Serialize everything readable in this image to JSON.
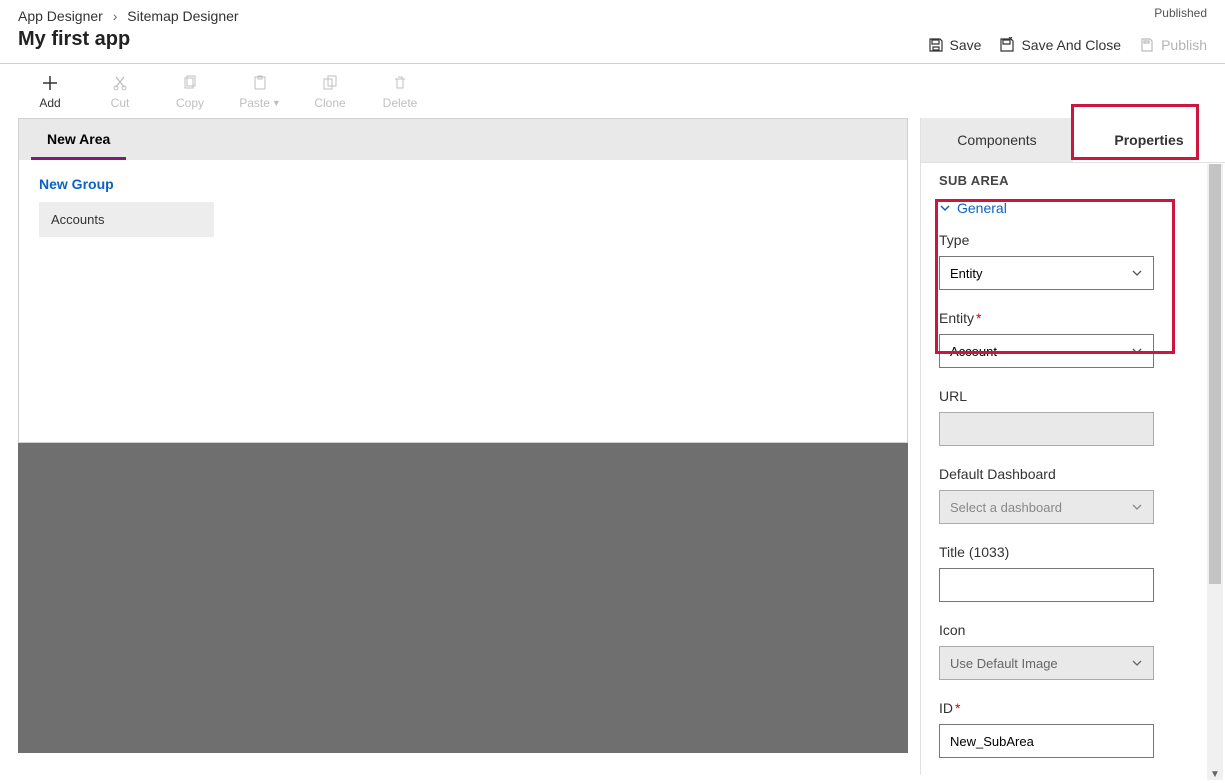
{
  "breadcrumb": {
    "root": "App Designer",
    "current": "Sitemap Designer"
  },
  "app_title": "My first app",
  "status": "Published",
  "header_actions": {
    "save": "Save",
    "save_close": "Save And Close",
    "publish": "Publish"
  },
  "toolbar": {
    "add": "Add",
    "cut": "Cut",
    "copy": "Copy",
    "paste": "Paste",
    "clone": "Clone",
    "delete": "Delete"
  },
  "canvas": {
    "area": "New Area",
    "group": "New Group",
    "subarea": "Accounts"
  },
  "tabs": {
    "components": "Components",
    "properties": "Properties"
  },
  "panel": {
    "title": "SUB AREA",
    "section": "General",
    "fields": {
      "type": {
        "label": "Type",
        "value": "Entity"
      },
      "entity": {
        "label": "Entity",
        "value": "Account"
      },
      "url": {
        "label": "URL",
        "value": ""
      },
      "dashboard": {
        "label": "Default Dashboard",
        "placeholder": "Select a dashboard"
      },
      "title": {
        "label": "Title (1033)",
        "value": ""
      },
      "icon": {
        "label": "Icon",
        "value": "Use Default Image"
      },
      "id": {
        "label": "ID",
        "value": "New_SubArea"
      }
    }
  }
}
